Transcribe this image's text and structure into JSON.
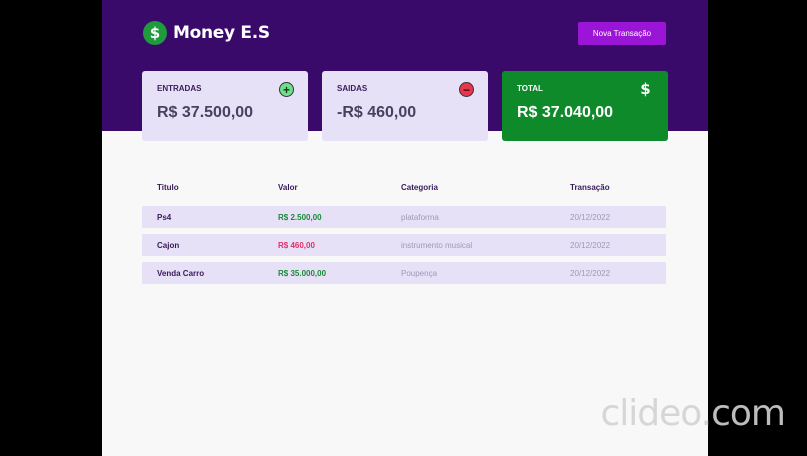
{
  "header": {
    "logo_symbol": "$",
    "logo_text": "Money E.S",
    "new_transaction_label": "Nova Transação"
  },
  "summary": {
    "income": {
      "label": "ENTRADAS",
      "value": "R$ 37.500,00",
      "icon": "plus-circle-icon"
    },
    "expenses": {
      "label": "SAIDAS",
      "value": "-R$ 460,00",
      "icon": "minus-circle-icon"
    },
    "total": {
      "label": "TOTAL",
      "value": "R$ 37.040,00",
      "icon": "dollar-icon",
      "dollar_symbol": "$"
    }
  },
  "table": {
    "headers": [
      "Titulo",
      "Valor",
      "Categoria",
      "Transação"
    ],
    "rows": [
      {
        "title": "Ps4",
        "value": "R$ 2.500,00",
        "type": "income",
        "category": "plataforma",
        "date": "20/12/2022"
      },
      {
        "title": "Cajon",
        "value": "R$ 460,00",
        "type": "expense",
        "category": "instrumento musical",
        "date": "20/12/2022"
      },
      {
        "title": "Venda Carro",
        "value": "R$ 35.000,00",
        "type": "income",
        "category": "Poupença",
        "date": "20/12/2022"
      }
    ]
  },
  "watermark": "clideo.com",
  "colors": {
    "header_bg": "#3a0a6b",
    "button_bg": "#9b15d6",
    "card_bg": "#e6e1f6",
    "total_bg": "#0f8a2a",
    "income_color": "#1a8a3a",
    "expense_color": "#e0306a"
  }
}
